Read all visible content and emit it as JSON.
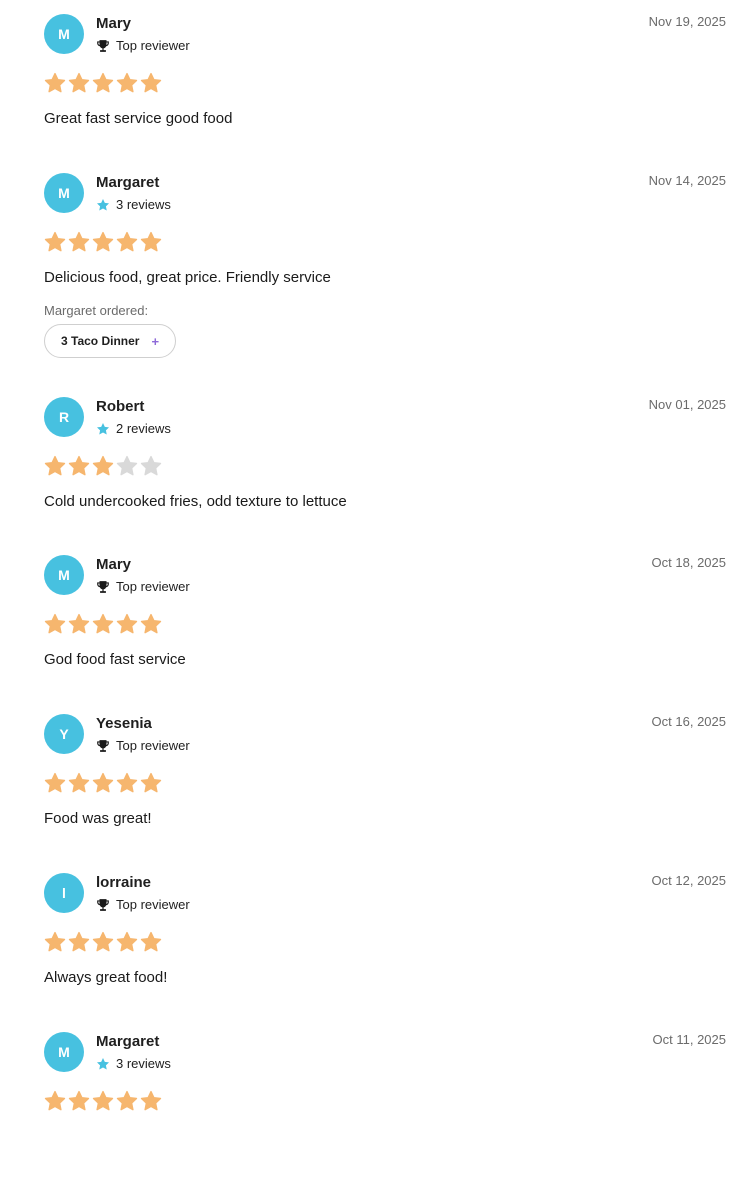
{
  "colors": {
    "avatar_bg": "#47c1e0",
    "star_filled": "#f6b66e",
    "star_empty": "#d9d9d9",
    "reviews_star_icon": "#47c1e0",
    "plus_accent": "#8e6ad8"
  },
  "reviews": [
    {
      "initial": "M",
      "name": "Mary",
      "badge_icon": "trophy-icon",
      "badge_text": "Top reviewer",
      "date": "Nov 19, 2025",
      "rating": 5,
      "text": "Great fast service good food"
    },
    {
      "initial": "M",
      "name": "Margaret",
      "badge_icon": "star-icon",
      "badge_text": "3 reviews",
      "date": "Nov 14, 2025",
      "rating": 5,
      "text": "Delicious food, great price. Friendly service",
      "ordered_label": "Margaret ordered:",
      "ordered_item": "3 Taco Dinner",
      "ordered_plus": "+"
    },
    {
      "initial": "R",
      "name": "Robert",
      "badge_icon": "star-icon",
      "badge_text": "2 reviews",
      "date": "Nov 01, 2025",
      "rating": 3,
      "text": "Cold undercooked fries, odd texture to lettuce"
    },
    {
      "initial": "M",
      "name": "Mary",
      "badge_icon": "trophy-icon",
      "badge_text": "Top reviewer",
      "date": "Oct 18, 2025",
      "rating": 5,
      "text": "God food fast service"
    },
    {
      "initial": "Y",
      "name": "Yesenia",
      "badge_icon": "trophy-icon",
      "badge_text": "Top reviewer",
      "date": "Oct 16, 2025",
      "rating": 5,
      "text": "Food was great!"
    },
    {
      "initial": "l",
      "name": "lorraine",
      "badge_icon": "trophy-icon",
      "badge_text": "Top reviewer",
      "date": "Oct 12, 2025",
      "rating": 5,
      "text": "Always great food!"
    },
    {
      "initial": "M",
      "name": "Margaret",
      "badge_icon": "star-icon",
      "badge_text": "3 reviews",
      "date": "Oct 11, 2025",
      "rating": 5,
      "text": ""
    }
  ]
}
